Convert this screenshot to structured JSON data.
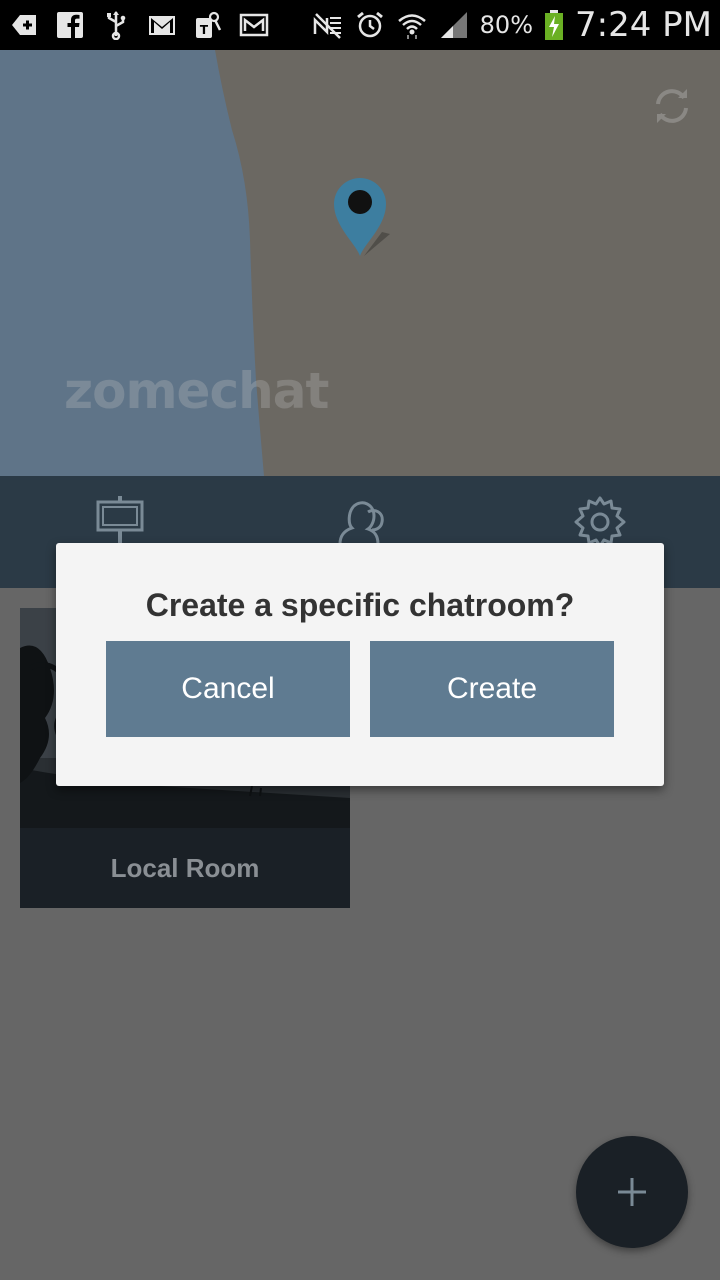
{
  "status_bar": {
    "battery_percent": "80%",
    "time": "7:24 PM",
    "icons": [
      "add-icon",
      "facebook-icon",
      "usb-icon",
      "gmail-icon",
      "tmobile-icon",
      "mail-icon",
      "no-signal-icon",
      "alarm-icon",
      "wifi-icon",
      "signal-icon",
      "battery-charging-icon"
    ]
  },
  "map": {
    "watermark": "zomechat",
    "water_color": "#5f7488",
    "land_color": "#6b6862",
    "pin_color": "#3d7ea0"
  },
  "nav": {
    "items": [
      "signboard-icon",
      "people-icon",
      "gear-icon"
    ],
    "background": "#2b3a46"
  },
  "rooms": [
    {
      "label": "Local Room"
    }
  ],
  "dialog": {
    "title": "Create a specific chatroom?",
    "cancel_label": "Cancel",
    "create_label": "Create",
    "button_color": "#5f7b91"
  },
  "fab": {
    "icon": "plus-icon"
  }
}
